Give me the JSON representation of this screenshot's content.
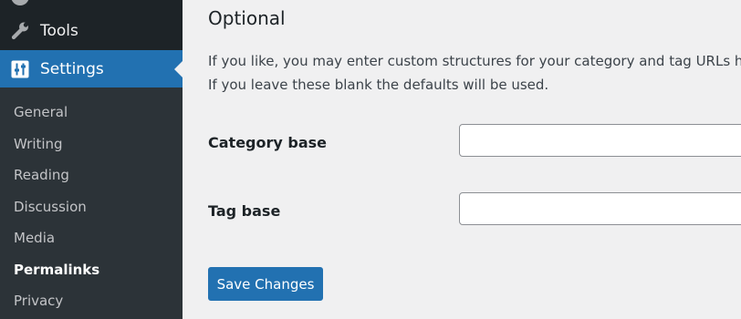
{
  "sidebar": {
    "tools": {
      "label": "Tools",
      "icon": "wrench-icon"
    },
    "settings": {
      "label": "Settings",
      "icon": "settings-sliders-icon"
    },
    "submenu": [
      {
        "label": "General",
        "current": false
      },
      {
        "label": "Writing",
        "current": false
      },
      {
        "label": "Reading",
        "current": false
      },
      {
        "label": "Discussion",
        "current": false
      },
      {
        "label": "Media",
        "current": false
      },
      {
        "label": "Permalinks",
        "current": true
      },
      {
        "label": "Privacy",
        "current": false
      }
    ]
  },
  "main": {
    "section_title": "Optional",
    "description": "If you like, you may enter custom structures for your category and tag URLs here. If you leave these blank the defaults will be used.",
    "fields": [
      {
        "label": "Category base",
        "value": "",
        "placeholder": ""
      },
      {
        "label": "Tag base",
        "value": "",
        "placeholder": ""
      }
    ],
    "save_label": "Save Changes"
  },
  "colors": {
    "sidebar_bg": "#1d2327",
    "submenu_bg": "#2c3338",
    "accent": "#2271b1",
    "content_bg": "#f0f0f1"
  }
}
